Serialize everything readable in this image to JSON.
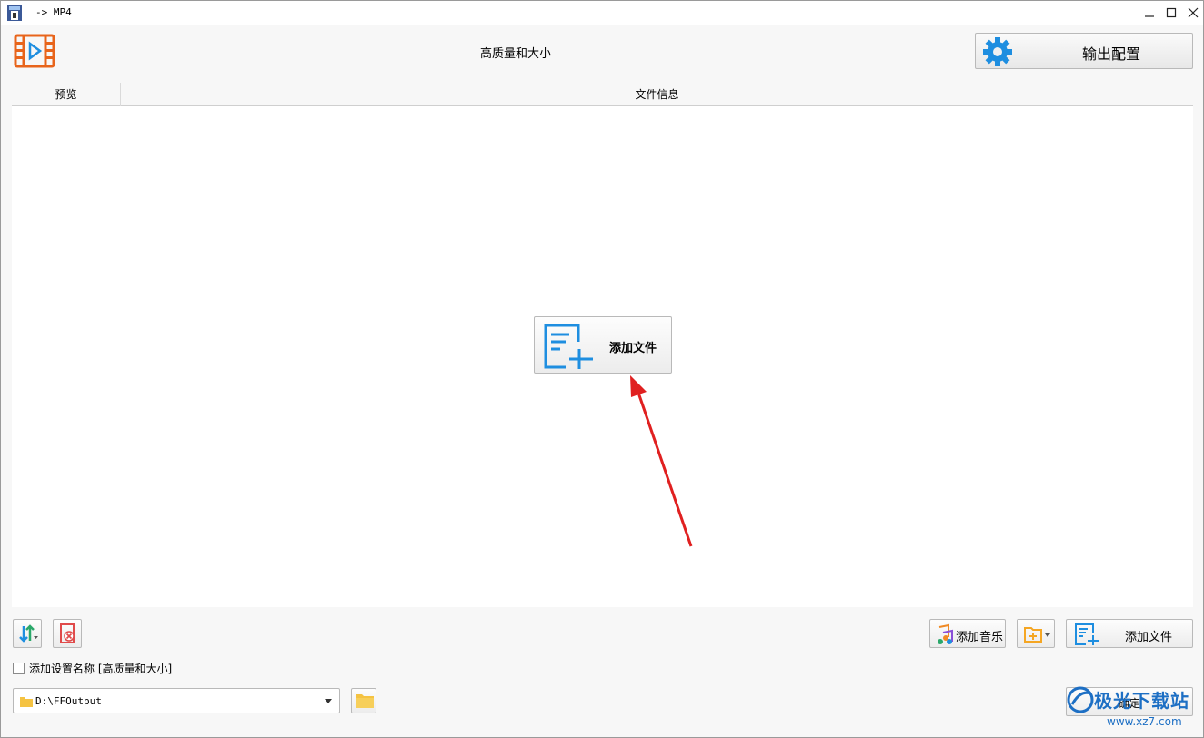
{
  "window": {
    "title": "-> MP4"
  },
  "header": {
    "profile_name": "高质量和大小",
    "output_config_label": "输出配置"
  },
  "file_list": {
    "columns": [
      "预览",
      "文件信息"
    ],
    "center_add_label": "添加文件"
  },
  "toolbar": {
    "add_music_label": "添加音乐",
    "add_file_label": "添加文件",
    "ok_label": "确定"
  },
  "options": {
    "append_setting_name_label": "添加设置名称 [高质量和大小]",
    "append_setting_name_checked": false
  },
  "output": {
    "path": "D:\\FFOutput"
  },
  "watermark": {
    "text": "极光下载站",
    "url": "www.xz7.com"
  },
  "colors": {
    "accent_blue": "#1e8ee0",
    "logo_orange": "#e8641b",
    "arrow_red": "#e02020",
    "folder_yellow": "#f5c342"
  }
}
